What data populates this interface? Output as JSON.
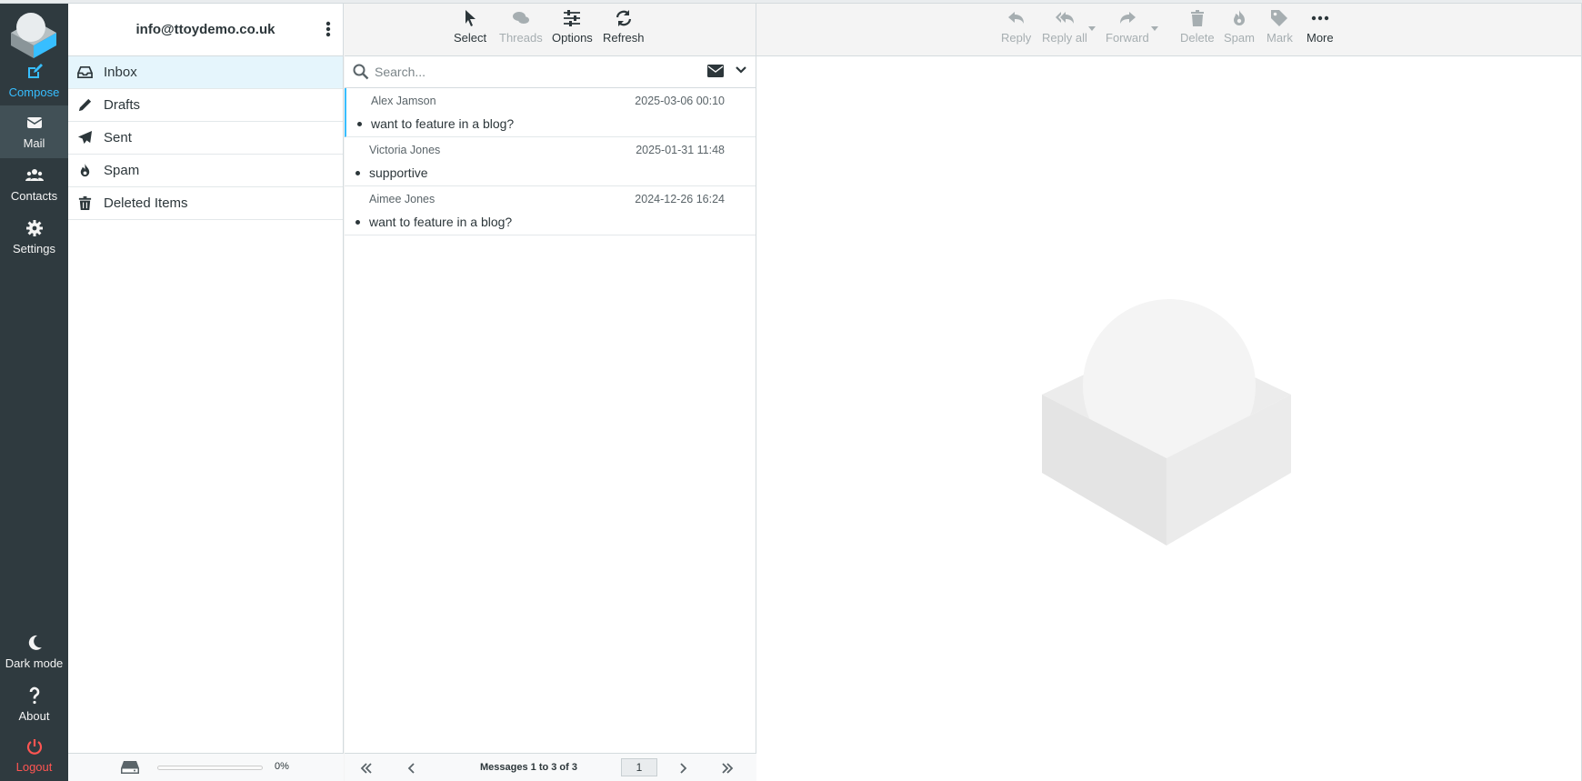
{
  "colors": {
    "nav_bg": "#2f3a3f",
    "accent": "#37beff",
    "logout": "#ff5552",
    "selected_folder_bg": "#e5f5fc"
  },
  "nav": {
    "compose": "Compose",
    "mail": "Mail",
    "contacts": "Contacts",
    "settings": "Settings",
    "dark_mode": "Dark mode",
    "about": "About",
    "logout": "Logout"
  },
  "account": {
    "email": "info@ttoydemo.co.uk"
  },
  "folders": [
    {
      "label": "Inbox",
      "icon": "inbox-icon",
      "selected": true
    },
    {
      "label": "Drafts",
      "icon": "pencil-icon"
    },
    {
      "label": "Sent",
      "icon": "paper-plane-icon"
    },
    {
      "label": "Spam",
      "icon": "fire-icon"
    },
    {
      "label": "Deleted Items",
      "icon": "trash-icon"
    }
  ],
  "quota": {
    "percent_label": "0%"
  },
  "list_toolbar": {
    "select": "Select",
    "threads": "Threads",
    "options": "Options",
    "refresh": "Refresh"
  },
  "search": {
    "placeholder": "Search..."
  },
  "messages": [
    {
      "from": "Alex Jamson",
      "date": "2025-03-06 00:10",
      "subject": "want to feature in a blog?"
    },
    {
      "from": "Victoria Jones",
      "date": "2025-01-31 11:48",
      "subject": "supportive"
    },
    {
      "from": "Aimee Jones",
      "date": "2024-12-26 16:24",
      "subject": "want to feature in a blog?"
    }
  ],
  "pager": {
    "count_label": "Messages 1 to 3 of 3",
    "page": "1"
  },
  "reader_toolbar": {
    "reply": "Reply",
    "reply_all": "Reply all",
    "forward": "Forward",
    "delete": "Delete",
    "spam": "Spam",
    "mark": "Mark",
    "more": "More"
  }
}
